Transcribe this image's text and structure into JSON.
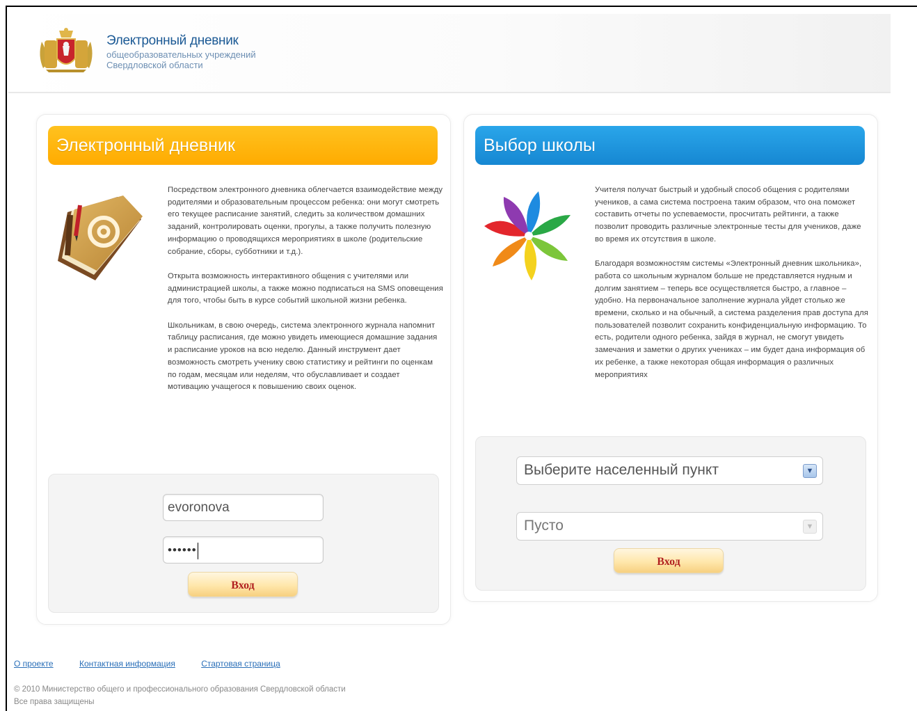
{
  "header": {
    "title": "Электронный дневник",
    "subtitle_line1": "общеобразовательных учреждений",
    "subtitle_line2": "Свердловской области"
  },
  "left_panel": {
    "banner": "Электронный дневник",
    "icon": "address-book-icon",
    "paragraphs": [
      "Посредством электронного дневника облегчается взаимодействие между родителями и образовательным процессом ребенка: они могут смотреть его текущее расписание занятий, следить за количеством домашних заданий, контролировать оценки, прогулы, а также получить полезную информацию о проводящихся мероприятиях в школе (родительские собрание, сборы, субботники и т.д.).",
      "Открыта возможность интерактивного общения с учителями или администрацией школы, а также можно подписаться на SMS оповещения для того, чтобы быть в курсе событий школьной жизни ребенка.",
      "Школьникам, в свою очередь, система электронного журнала напомнит таблицу расписания, где можно увидеть имеющиеся домашние задания и расписание уроков на всю неделю. Данный инструмент дает возможность смотреть ученику свою статистику и рейтинги по оценкам по годам, месяцам или неделям, что обуславливает и создает мотивацию учащегося к повышению своих оценок."
    ],
    "login_value": "evoronova",
    "password_value": "••••••",
    "login_button": "Вход"
  },
  "right_panel": {
    "banner": "Выбор школы",
    "icon": "pinwheel-icon",
    "paragraphs": [
      "Учителя получат быстрый и удобный способ общения с родителями учеников, а сама система построена таким образом, что она поможет составить отчеты по успеваемости, просчитать рейтинги, а также позволит проводить различные электронные тесты для учеников, даже во время их отсутствия в школе.",
      "Благодаря возможностям системы «Электронный дневник школьника», работа со школьным журналом больше не представляется нудным и долгим занятием – теперь все осуществляется быстро, а главное – удобно. На первоначальное заполнение журнала уйдет столько же времени, сколько и на обычный, а система разделения прав доступа для пользователей позволит сохранить конфиденциальную информацию. То есть, родители одного ребенка, зайдя в журнал, не смогут увидеть замечания и заметки о других учениках – им будет дана информация об их ребенке, а также некоторая общая информация о различных мероприятиях"
    ],
    "city_select": "Выберите населенный пункт",
    "school_select": "Пусто",
    "login_button": "Вход"
  },
  "footer": {
    "links": [
      "О проекте",
      "Контактная информация",
      "Стартовая страница"
    ],
    "copyright_line1": "© 2010 Министерство общего и профессионального образования Свердловской области",
    "copyright_line2": "Все права защищены"
  },
  "colors": {
    "orange_banner": "#ffb300",
    "blue_banner": "#1b93dc",
    "button_text": "#b12020",
    "link": "#2a6fb8"
  }
}
